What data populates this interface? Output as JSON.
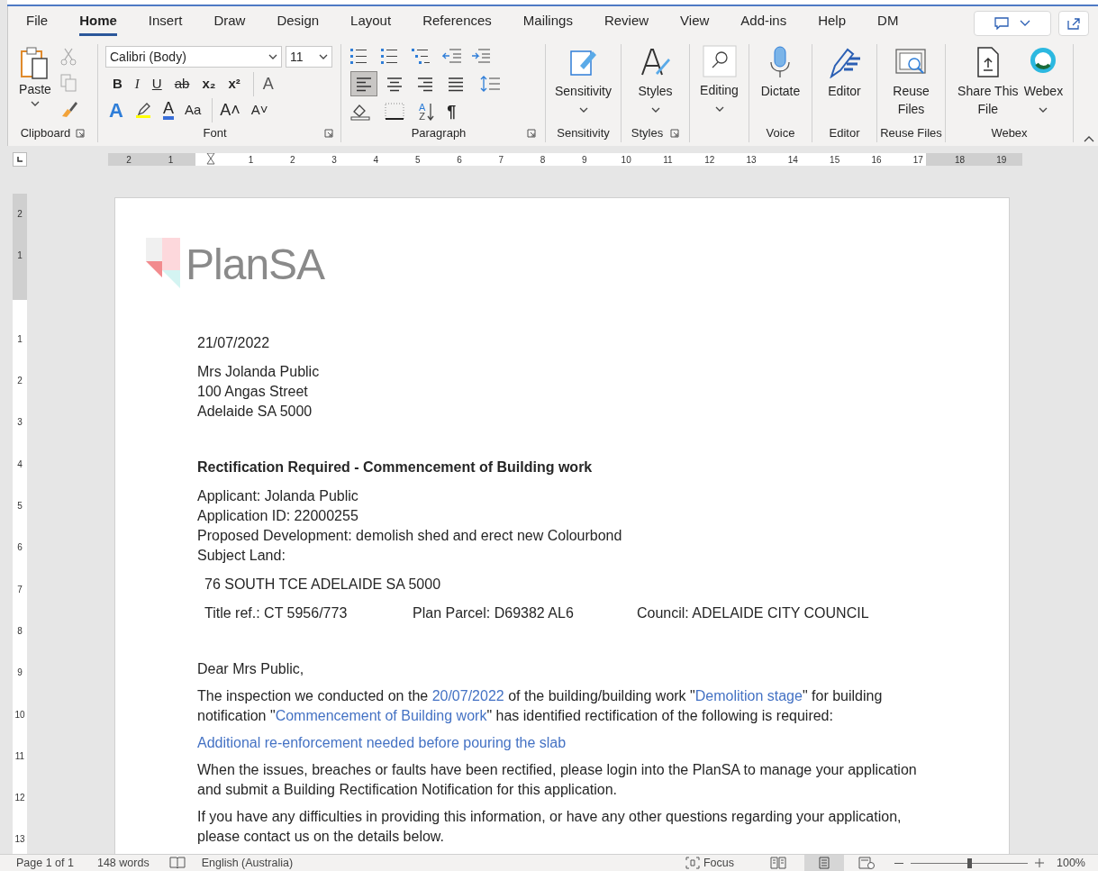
{
  "tabs": [
    {
      "label": "File",
      "selected": false
    },
    {
      "label": "Home",
      "selected": true
    },
    {
      "label": "Insert",
      "selected": false
    },
    {
      "label": "Draw",
      "selected": false
    },
    {
      "label": "Design",
      "selected": false
    },
    {
      "label": "Layout",
      "selected": false
    },
    {
      "label": "References",
      "selected": false
    },
    {
      "label": "Mailings",
      "selected": false
    },
    {
      "label": "Review",
      "selected": false
    },
    {
      "label": "View",
      "selected": false
    },
    {
      "label": "Add-ins",
      "selected": false
    },
    {
      "label": "Help",
      "selected": false
    },
    {
      "label": "DM",
      "selected": false
    }
  ],
  "ribbon": {
    "clipboard": {
      "paste": "Paste",
      "label": "Clipboard"
    },
    "font": {
      "face": "Calibri (Body)",
      "size": "11",
      "bold": "B",
      "italic": "I",
      "underline": "U",
      "strikethrough": "ab",
      "subscript": "x₂",
      "superscript": "x²",
      "clear": "A",
      "effects": "A",
      "font_color_letter": "A",
      "change_case": "Aa",
      "grow": "A˄",
      "shrink": "A˅",
      "label": "Font"
    },
    "paragraph": {
      "alignments": [
        {
          "kind": "left",
          "selected": true
        },
        {
          "kind": "center",
          "selected": false
        },
        {
          "kind": "right",
          "selected": false
        },
        {
          "kind": "justify",
          "selected": false
        }
      ],
      "sort_top": "A",
      "sort_bottom": "Z",
      "pilcrow": "¶",
      "label": "Paragraph"
    },
    "sensitivity": {
      "button": "Sensitivity",
      "label": "Sensitivity"
    },
    "styles": {
      "button": "Styles",
      "label": "Styles"
    },
    "editing": {
      "button": "Editing"
    },
    "voice": {
      "button": "Dictate",
      "label": "Voice"
    },
    "editor": {
      "button": "Editor",
      "label": "Editor"
    },
    "reuse_files": {
      "button": "Reuse Files",
      "label": "Reuse Files"
    },
    "webex": {
      "share": "Share This File",
      "webex": "Webex",
      "label": "Webex"
    }
  },
  "ruler": [
    "2",
    "1",
    "1",
    "2",
    "3",
    "4",
    "5",
    "6",
    "7",
    "8",
    "9",
    "10",
    "11",
    "12",
    "13",
    "14",
    "15",
    "16",
    "17",
    "18",
    "19"
  ],
  "vertical_ruler": [
    "2",
    "1",
    "1",
    "2",
    "3",
    "4",
    "5",
    "6",
    "7",
    "8",
    "9",
    "10",
    "11",
    "12",
    "13"
  ],
  "document": {
    "logo": "PlanSA",
    "date": "21/07/2022",
    "address": [
      "Mrs Jolanda Public",
      "100 Angas Street",
      "Adelaide SA 5000"
    ],
    "heading": "Rectification Required - Commencement of Building work",
    "details": [
      "Applicant: Jolanda Public",
      "Application ID: 22000255",
      "Proposed Development: demolish shed and erect new Colourbond",
      "Subject Land:"
    ],
    "land_address": "76 SOUTH TCE ADELAIDE SA 5000",
    "land_refs": [
      "Title ref.: CT 5956/773",
      "Plan Parcel: D69382 AL6",
      "Council: ADELAIDE CITY COUNCIL"
    ],
    "greeting": "Dear Mrs Public,",
    "paragraphs": [
      [
        {
          "kind": "plain",
          "text": "The inspection we conducted on the "
        },
        {
          "kind": "field",
          "text": "20/07/2022"
        },
        {
          "kind": "plain",
          "text": " of the building/building work \""
        },
        {
          "kind": "field",
          "text": "Demolition stage"
        },
        {
          "kind": "plain",
          "text": "\" for building notification \""
        },
        {
          "kind": "field",
          "text": "Commencement of Building work"
        },
        {
          "kind": "plain",
          "text": "\" has identified rectification of the following is required:"
        }
      ],
      [
        {
          "kind": "field",
          "text": "Additional re-enforcement needed before pouring the slab"
        }
      ],
      [
        {
          "kind": "plain",
          "text": "When the issues, breaches or faults have been rectified, please login into the PlanSA to manage your application and submit a Building Rectification Notification for this application."
        }
      ],
      [
        {
          "kind": "plain",
          "text": "If you have any difficulties in providing this information, or have any other questions regarding your application, please contact us on the details below."
        }
      ]
    ]
  },
  "status_bar": {
    "page": "Page 1 of 1",
    "words": "148 words",
    "language": "English (Australia)",
    "focus": "Focus",
    "zoom": {
      "level": 0.5
    },
    "zoom_label": "100%"
  }
}
